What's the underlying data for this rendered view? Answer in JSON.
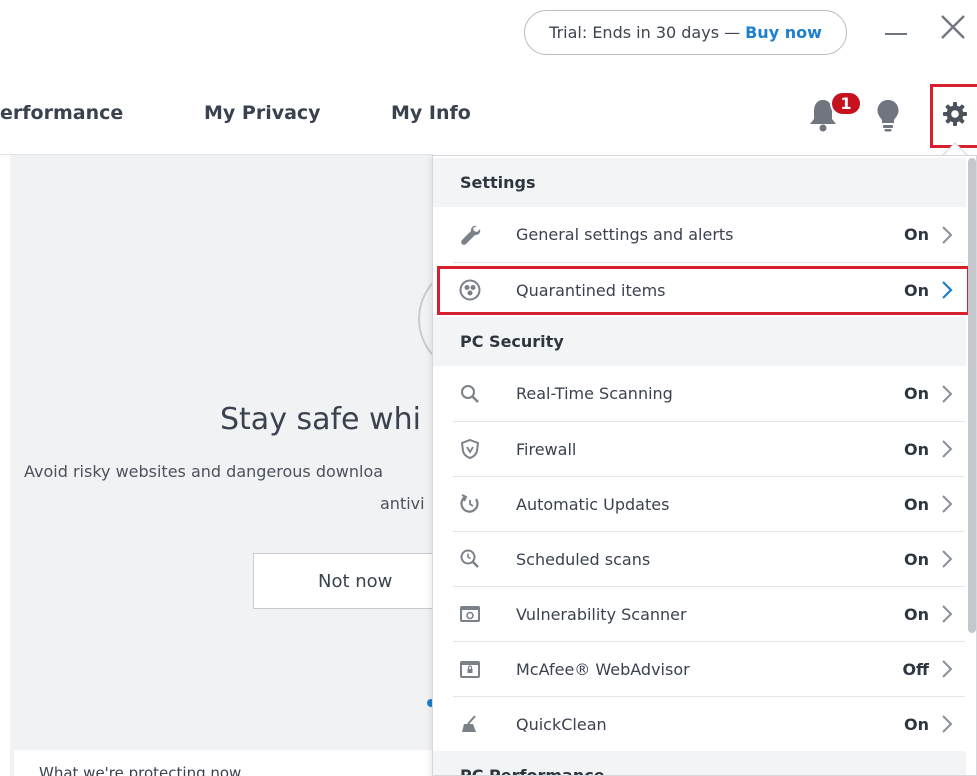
{
  "topbar": {
    "trial_text": "Trial: Ends in 30 days —",
    "buy_label": "Buy now"
  },
  "nav": {
    "tab_performance": "erformance",
    "tab_privacy": "My Privacy",
    "tab_info": "My Info",
    "notification_count": "1"
  },
  "background": {
    "heading": "Stay safe whi",
    "text_line1": "Avoid risky websites and dangerous downloa",
    "text_line2": "antivi",
    "not_now_label": "Not now",
    "card_text": "What we're protecting now"
  },
  "menu": {
    "settings_header": "Settings",
    "general_label": "General settings and alerts",
    "general_status": "On",
    "quarantine_label": "Quarantined items",
    "quarantine_status": "On",
    "security_header": "PC Security",
    "rts_label": "Real-Time Scanning",
    "rts_status": "On",
    "firewall_label": "Firewall",
    "firewall_status": "On",
    "updates_label": "Automatic Updates",
    "updates_status": "On",
    "scheduled_label": "Scheduled scans",
    "scheduled_status": "On",
    "vuln_label": "Vulnerability Scanner",
    "vuln_status": "On",
    "webadvisor_label": "McAfee® WebAdvisor",
    "webadvisor_status": "Off",
    "quickclean_label": "QuickClean",
    "quickclean_status": "On",
    "performance_header": "PC Performance"
  },
  "colors": {
    "accent": "#1d7fce",
    "highlight": "#d6202e",
    "badge": "#c6121f"
  },
  "icons": [
    "close-icon",
    "minimize-icon",
    "bell-icon",
    "lightbulb-icon",
    "gear-icon",
    "wrench-icon",
    "biohazard-icon",
    "search-icon",
    "shield-icon",
    "refresh-icon",
    "clock-search-icon",
    "monitor-icon",
    "lock-screen-icon",
    "broom-icon",
    "chevron-right-icon"
  ]
}
